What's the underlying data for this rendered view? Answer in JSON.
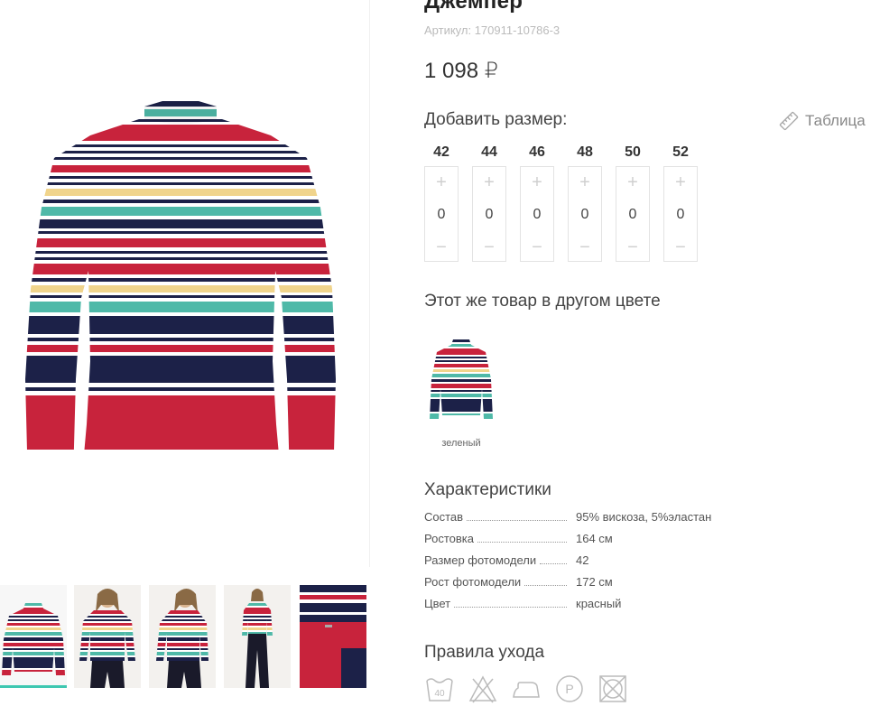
{
  "product": {
    "title": "Джемпер",
    "sku_label": "Артикул:",
    "sku_value": "170911-10786-3",
    "price": "1 098 ₽"
  },
  "sizes_block": {
    "title": "Добавить размер:",
    "table_link": "Таблица",
    "plus": "+",
    "minus": "−",
    "sizes": [
      {
        "label": "42",
        "qty": "0"
      },
      {
        "label": "44",
        "qty": "0"
      },
      {
        "label": "46",
        "qty": "0"
      },
      {
        "label": "48",
        "qty": "0"
      },
      {
        "label": "50",
        "qty": "0"
      },
      {
        "label": "52",
        "qty": "0"
      }
    ]
  },
  "other_color": {
    "title": "Этот же товар в другом цвете",
    "items": [
      {
        "label": "зеленый"
      }
    ]
  },
  "characteristics": {
    "title": "Характеристики",
    "rows": [
      {
        "name": "Состав",
        "value": "95% вискоза, 5%эластан"
      },
      {
        "name": "Ростовка",
        "value": "164 см"
      },
      {
        "name": "Размер фотомодели",
        "value": "42"
      },
      {
        "name": "Рост фотомодели",
        "value": "172 см"
      },
      {
        "name": "Цвет",
        "value": "красный"
      }
    ]
  },
  "care": {
    "title": "Правила ухода",
    "wash_temp": "40",
    "professional_clean_letter": "P",
    "icons": [
      "wash-40-icon",
      "no-bleach-icon",
      "iron-icon",
      "professional-clean-icon",
      "no-tumble-dry-icon"
    ]
  },
  "colors": {
    "accent": "#3ec7b0",
    "stripe_red": "#c8233c",
    "stripe_navy": "#1c2148",
    "stripe_teal": "#4fb9a8",
    "stripe_yellow": "#f0d48c"
  }
}
